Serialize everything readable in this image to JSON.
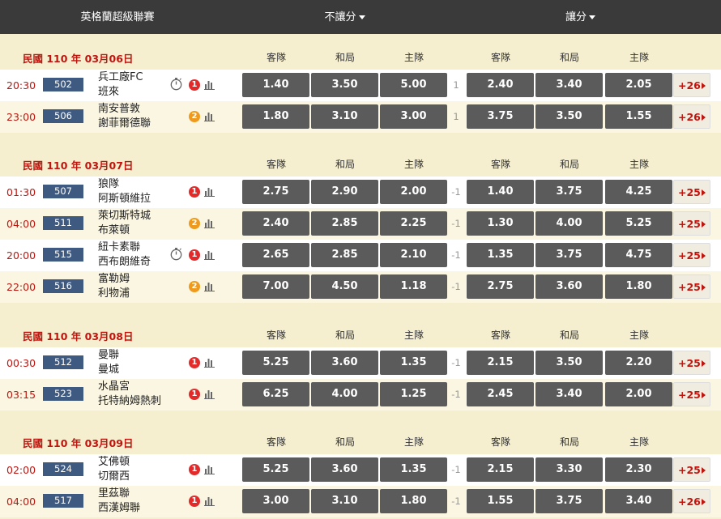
{
  "header": {
    "league": "英格蘭超級聯賽",
    "no_handicap": "不讓分",
    "handicap": "讓分"
  },
  "columns": [
    "客隊",
    "和局",
    "主隊",
    "客隊",
    "和局",
    "主隊"
  ],
  "groups": [
    {
      "date": "民國 110 年 03月06日",
      "matches": [
        {
          "time": "20:30",
          "code": "502",
          "away": "兵工廠FC",
          "home": "班來",
          "timer": true,
          "badge": "1",
          "odds": [
            "1.40",
            "3.50",
            "5.00"
          ],
          "handicap": "1",
          "hodds": [
            "2.40",
            "3.40",
            "2.05"
          ],
          "more": "+26"
        },
        {
          "time": "23:00",
          "code": "506",
          "away": "南安普敦",
          "home": "謝菲爾德聯",
          "timer": false,
          "badge": "2",
          "odds": [
            "1.80",
            "3.10",
            "3.00"
          ],
          "handicap": "1",
          "hodds": [
            "3.75",
            "3.50",
            "1.55"
          ],
          "more": "+26"
        }
      ]
    },
    {
      "date": "民國 110 年 03月07日",
      "matches": [
        {
          "time": "01:30",
          "code": "507",
          "away": "狼隊",
          "home": "阿斯頓維拉",
          "timer": false,
          "badge": "1",
          "odds": [
            "2.75",
            "2.90",
            "2.00"
          ],
          "handicap": "-1",
          "hodds": [
            "1.40",
            "3.75",
            "4.25"
          ],
          "more": "+25"
        },
        {
          "time": "04:00",
          "code": "511",
          "away": "萊切斯特城",
          "home": "布萊頓",
          "timer": false,
          "badge": "2",
          "odds": [
            "2.40",
            "2.85",
            "2.25"
          ],
          "handicap": "-1",
          "hodds": [
            "1.30",
            "4.00",
            "5.25"
          ],
          "more": "+25"
        },
        {
          "time": "20:00",
          "code": "515",
          "away": "紐卡素聯",
          "home": "西布朗維奇",
          "timer": true,
          "badge": "1",
          "odds": [
            "2.65",
            "2.85",
            "2.10"
          ],
          "handicap": "-1",
          "hodds": [
            "1.35",
            "3.75",
            "4.75"
          ],
          "more": "+25"
        },
        {
          "time": "22:00",
          "code": "516",
          "away": "富勒姆",
          "home": "利物浦",
          "timer": false,
          "badge": "2",
          "odds": [
            "7.00",
            "4.50",
            "1.18"
          ],
          "handicap": "-1",
          "hodds": [
            "2.75",
            "3.60",
            "1.80"
          ],
          "more": "+25"
        }
      ]
    },
    {
      "date": "民國 110 年 03月08日",
      "matches": [
        {
          "time": "00:30",
          "code": "512",
          "away": "曼聯",
          "home": "曼城",
          "timer": false,
          "badge": "1",
          "odds": [
            "5.25",
            "3.60",
            "1.35"
          ],
          "handicap": "-1",
          "hodds": [
            "2.15",
            "3.50",
            "2.20"
          ],
          "more": "+25"
        },
        {
          "time": "03:15",
          "code": "523",
          "away": "水晶宮",
          "home": "托特納姆熱刺",
          "timer": false,
          "badge": "1",
          "odds": [
            "6.25",
            "4.00",
            "1.25"
          ],
          "handicap": "-1",
          "hodds": [
            "2.45",
            "3.40",
            "2.00"
          ],
          "more": "+25"
        }
      ]
    },
    {
      "date": "民國 110 年 03月09日",
      "matches": [
        {
          "time": "02:00",
          "code": "524",
          "away": "艾佛頓",
          "home": "切爾西",
          "timer": false,
          "badge": "1",
          "odds": [
            "5.25",
            "3.60",
            "1.35"
          ],
          "handicap": "-1",
          "hodds": [
            "2.15",
            "3.30",
            "2.30"
          ],
          "more": "+25"
        },
        {
          "time": "04:00",
          "code": "517",
          "away": "里茲聯",
          "home": "西漢姆聯",
          "timer": false,
          "badge": "1",
          "odds": [
            "3.00",
            "3.10",
            "1.80"
          ],
          "handicap": "-1",
          "hodds": [
            "1.55",
            "3.75",
            "3.40"
          ],
          "more": "+26"
        }
      ]
    }
  ],
  "icons": {
    "timer": "stopwatch-icon",
    "stats": "bar-chart-icon",
    "more_arrow": "caret-right-icon"
  },
  "colors": {
    "header_bg": "#3a3a3a",
    "date_red": "#c0150f",
    "odds_bg": "#5b5b5b",
    "code_bg": "#3f5a80",
    "badge_1": "#e22a2a",
    "badge_2": "#ef9a1d"
  }
}
